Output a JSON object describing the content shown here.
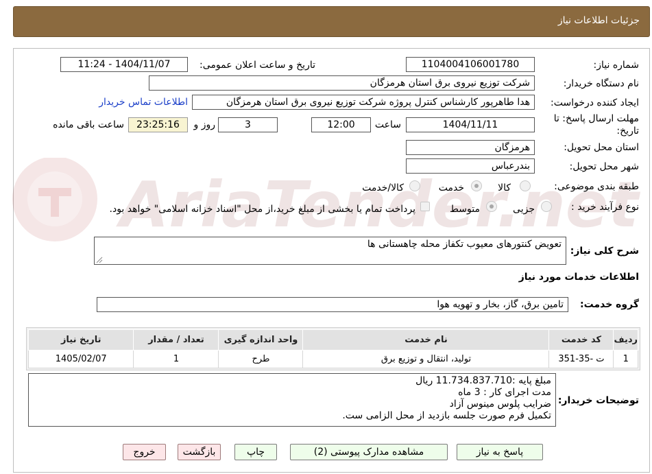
{
  "header": {
    "title": "جزئیات اطلاعات نیاز"
  },
  "fields": {
    "need_number_label": "شماره نیاز:",
    "need_number": "1104004106001780",
    "announce_label": "تاریخ و ساعت اعلان عمومی:",
    "announce_value": "1404/11/07 - 11:24",
    "buyer_label": "نام دستگاه خریدار:",
    "buyer_value": "شرکت توزیع نیروی برق استان هرمزگان",
    "creator_label": "ایجاد کننده درخواست:",
    "creator_value": "هدا طاهرپور کارشناس کنترل پروژه شرکت توزیع نیروی برق استان هرمزگان",
    "contact_link": "اطلاعات تماس خریدار",
    "deadline_label_line1": "مهلت ارسال پاسخ: تا",
    "deadline_label_line2": "تاریخ:",
    "deadline_date": "1404/11/11",
    "time_word": "ساعت",
    "deadline_time": "12:00",
    "days_value": "3",
    "days_word": "روز و",
    "remaining_time": "23:25:16",
    "remaining_word": "ساعت باقی مانده",
    "province_label": "استان محل تحویل:",
    "province_value": "هرمزگان",
    "city_label": "شهر محل تحویل:",
    "city_value": "بندرعباس",
    "category_label": "طبقه بندی موضوعی:",
    "category_options": [
      "کالا",
      "خدمت",
      "کالا/خدمت"
    ],
    "category_selected": "خدمت",
    "process_label": "نوع فرآیند خرید :",
    "process_options": [
      "جزیی",
      "متوسط"
    ],
    "process_selected": "متوسط",
    "treasury_note": "پرداخت تمام یا بخشی از مبلغ خرید،از محل \"اسناد خزانه اسلامی\" خواهد بود."
  },
  "summary": {
    "label": "شرح کلی نیاز:",
    "value": "تعویض کنتورهای معیوب تکفاز محله چاهستانی ها"
  },
  "services_section": {
    "title": "اطلاعات خدمات مورد نیاز",
    "group_label": "گروه خدمت:",
    "group_value": "تامین برق، گاز، بخار و تهویه هوا"
  },
  "table": {
    "headers": [
      "ردیف",
      "کد خدمت",
      "نام خدمت",
      "واحد اندازه گیری",
      "تعداد / مقدار",
      "تاریخ نیاز"
    ],
    "rows": [
      [
        "1",
        "ت -35-351",
        "تولید، انتقال و توزیع برق",
        "طرح",
        "1",
        "1405/02/07"
      ]
    ]
  },
  "buyer_notes": {
    "label": "توضیحات خریدار:",
    "lines": [
      "مبلغ پایه :11.734.837.710 ریال",
      "مدت اجرای کار : 3 ماه",
      "ضرایب پلوس مینوس آزاد",
      "تکمیل فرم صورت جلسه بازدید از محل الزامی ست."
    ]
  },
  "buttons": {
    "reply": "پاسخ به نیاز",
    "attachments": "مشاهده مدارک پیوستی (2)",
    "print": "چاپ",
    "back": "بازگشت",
    "exit": "خروج"
  },
  "watermark": {
    "text": "AriaTender.net"
  },
  "colors": {
    "header_bg": "#8b6a3f",
    "button_green": "#eefdea",
    "button_red": "#fde6e8",
    "time_box": "#f8f4d2"
  }
}
